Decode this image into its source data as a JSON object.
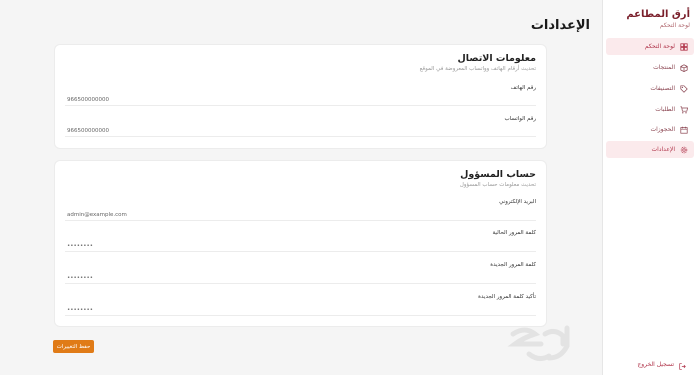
{
  "brand": {
    "title": "أرق المطاعم",
    "subtitle": "لوحة التحكم"
  },
  "nav": [
    {
      "label": "لوحة التحكم",
      "icon": "dashboard-icon",
      "active": true
    },
    {
      "label": "المنتجات",
      "icon": "box-icon",
      "active": false
    },
    {
      "label": "التصنيفات",
      "icon": "tag-icon",
      "active": false
    },
    {
      "label": "الطلبات",
      "icon": "cart-icon",
      "active": false
    },
    {
      "label": "الحجوزات",
      "icon": "calendar-icon",
      "active": false
    },
    {
      "label": "الإعدادات",
      "icon": "gear-icon",
      "active": true
    }
  ],
  "logout_label": "تسجيل الخروج",
  "page_title": "الإعدادات",
  "contact": {
    "title": "معلومات الاتصال",
    "subtitle": "تحديث أرقام الهاتف وواتساب المعروضة في الموقع",
    "phone_label": "رقم الهاتف",
    "phone_value": "966500000000",
    "whatsapp_label": "رقم الواتساب",
    "whatsapp_value": "966500000000"
  },
  "admin": {
    "title": "حساب المسؤول",
    "subtitle": "تحديث معلومات حساب المسؤول",
    "email_label": "البريد الإلكتروني",
    "email_value": "admin@example.com",
    "current_pw_label": "كلمة المرور الحالية",
    "current_pw_value": "••••••••",
    "new_pw_label": "كلمة المرور الجديدة",
    "new_pw_value": "••••••••",
    "confirm_pw_label": "تأكيد كلمة المرور الجديدة",
    "confirm_pw_value": "••••••••"
  },
  "save_label": "حفظ التغييرات",
  "watermark_text": "حراج",
  "colors": {
    "brand": "#7a1f2b",
    "accent": "#e07b17",
    "active_bg": "#fbeaec"
  }
}
